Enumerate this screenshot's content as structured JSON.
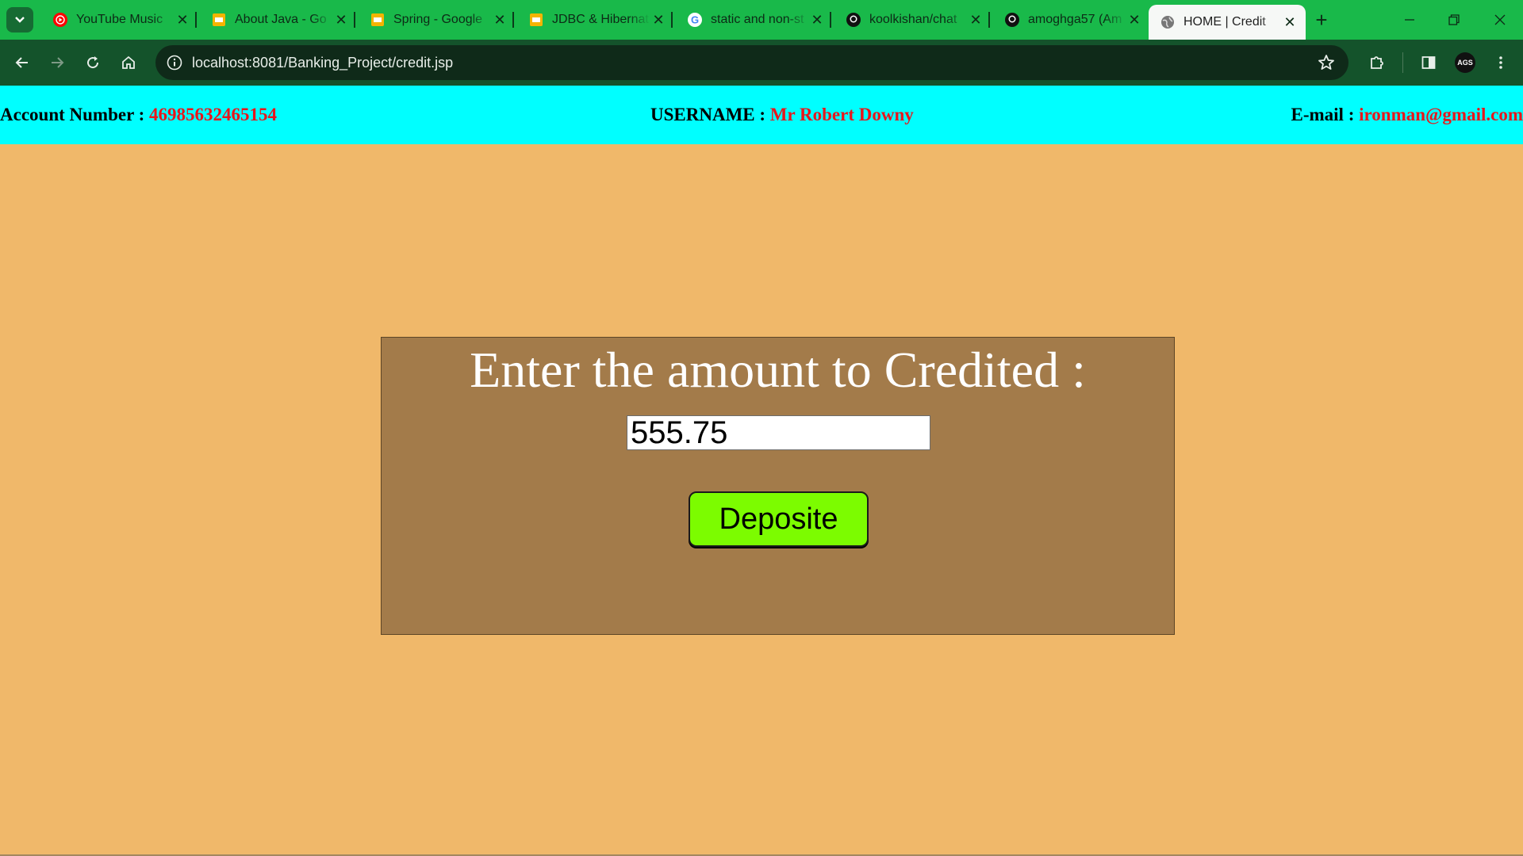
{
  "browser": {
    "tabs": [
      {
        "title": "YouTube Music",
        "icon": "youtube-music-icon",
        "active": false
      },
      {
        "title": "About Java - Go",
        "icon": "google-slides-icon",
        "active": false
      },
      {
        "title": "Spring - Google",
        "icon": "google-slides-icon",
        "active": false
      },
      {
        "title": "JDBC & Hibernat",
        "icon": "google-slides-icon",
        "active": false
      },
      {
        "title": "static and non-st",
        "icon": "google-icon",
        "active": false
      },
      {
        "title": "koolkishan/chat",
        "icon": "github-icon",
        "active": false
      },
      {
        "title": "amoghga57 (Am",
        "icon": "github-icon",
        "active": false
      },
      {
        "title": "HOME | Credit",
        "icon": "globe-icon",
        "active": true
      }
    ],
    "url": "localhost:8081/Banking_Project/credit.jsp",
    "profile_initials": "AGS",
    "colors": {
      "tabstrip": "#19b94a",
      "toolbar": "#14532b"
    }
  },
  "userbar": {
    "account_label": "Account Number : ",
    "account_value": "46985632465154",
    "username_label": "USERNAME : ",
    "username_value": "Mr Robert Downy",
    "email_label": "E-mail : ",
    "email_value": "ironman@gmail.com",
    "colors": {
      "background": "#00ffff",
      "value": "#e8161b"
    }
  },
  "credit_form": {
    "heading": "Enter the amount to Credited :",
    "amount_value": "555.75",
    "button_label": "Deposite",
    "colors": {
      "panel": "#a37b4a",
      "button": "#7cfc00",
      "page": "#f0b86a"
    }
  }
}
